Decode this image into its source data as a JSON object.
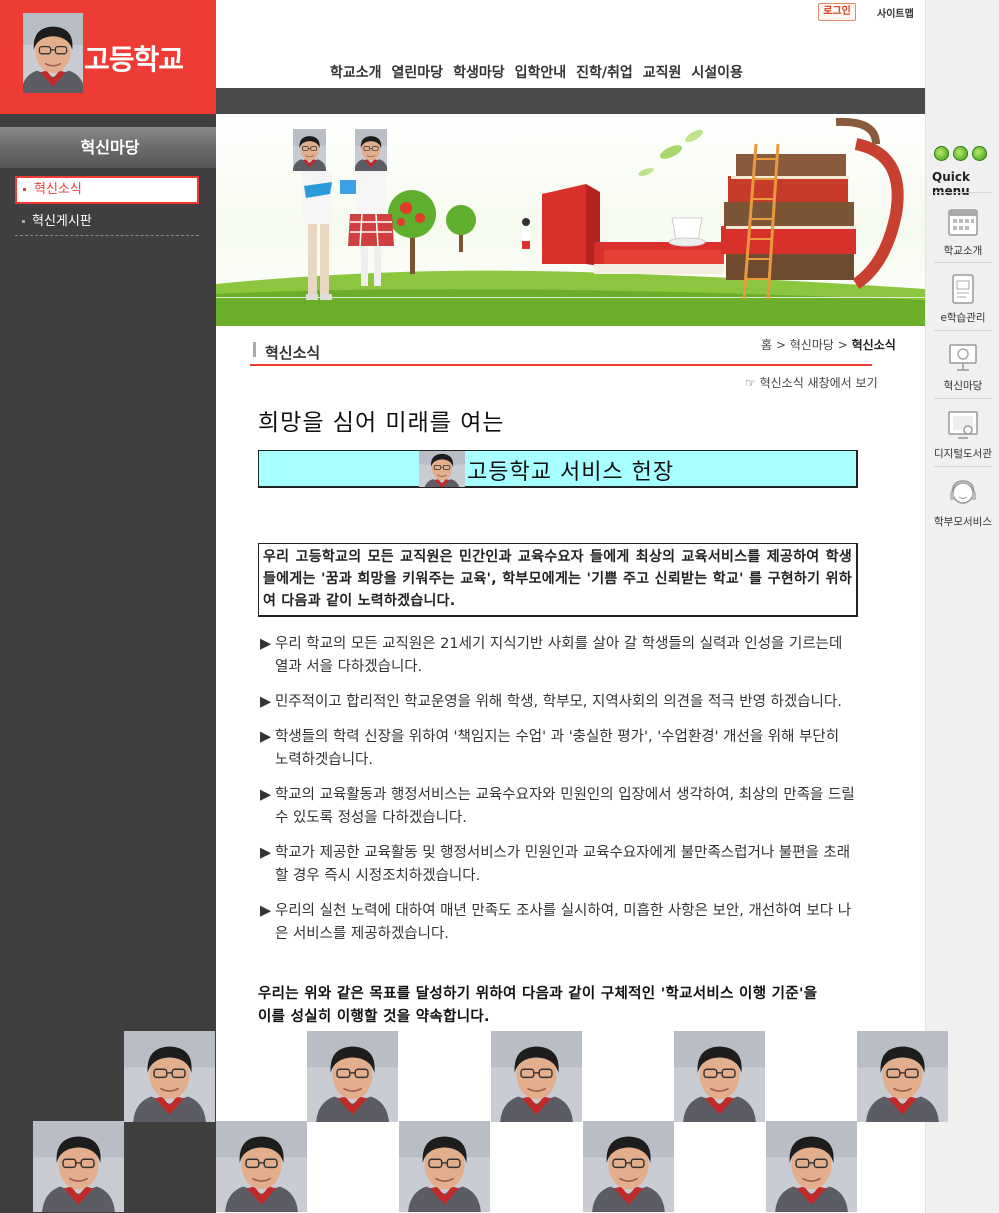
{
  "logo": {
    "title": "고등학교"
  },
  "util": {
    "login": "로그인",
    "sitemap": "사이트맵"
  },
  "gnb": [
    "학교소개",
    "열린마당",
    "학생마당",
    "입학안내",
    "진학/취업",
    "교직원",
    "시설이용"
  ],
  "sidebar": {
    "title": "혁신마당",
    "items": [
      {
        "label": "혁신소식",
        "active": true
      },
      {
        "label": "혁신게시판",
        "active": false
      }
    ]
  },
  "page": {
    "title": "혁신소식",
    "breadcrumb": [
      "홈",
      "혁신마당",
      "혁신소식"
    ],
    "new_window": "혁신소식 새창에서 보기"
  },
  "content": {
    "headline": "희망을 심어 미래를 여는",
    "banner_title": "고등학교 서비스 헌장",
    "intro": "우리       고등학교의 모든 교직원은 민간인과 교육수요자 들에게 최상의 교육서비스를 제공하여 학생들에게는 '꿈과 희망을 키워주는 교육', 학부모에게는 '기쁨 주고 신뢰받는 학교' 를 구현하기 위하여 다음과 같이 노력하겠습니다.",
    "bullets": [
      "우리 학교의 모든 교직원은 21세기 지식기반 사회를 살아 갈 학생들의 실력과 인성을 기르는데 열과 서을 다하겠습니다.",
      "민주적이고 합리적인 학교운영을 위해 학생, 학부모, 지역사회의 의견을 적극 반영 하겠습니다.",
      "학생들의 학력 신장을 위하여 '책임지는 수업' 과 '충실한 평가', '수업환경' 개선을 위해 부단히 노력하겟습니다.",
      "학교의 교육활동과 행정서비스는 교육수요자와 민원인의 입장에서 생각하여, 최상의 만족을 드릴 수 있도록 정성을 다하겠습니다.",
      "학교가 제공한 교육활동 및 행정서비스가 민원인과 교육수요자에게 불만족스럽거나 불편을 초래할 경우 즉시 시정조치하겠습니다.",
      "우리의 실천 노력에 대하여 매년 만족도 조사를 실시하여, 미흡한 사항은 보안, 개선하여 보다 나은 서비스를 제공하겠습니다."
    ],
    "bullet_marker": "▶",
    "pledge": "우리는 위와 같은 목표를 달성하기 위하여 다음과 같이 구체적인 '학교서비스 이행 기준'을 이를 성실히 이행할 것을 약속합니다."
  },
  "quick_menu": {
    "title": "Quick menu",
    "items": [
      {
        "label": "학교소개",
        "icon": "calendar-icon"
      },
      {
        "label": "e학습관리",
        "icon": "document-icon"
      },
      {
        "label": "혁신마당",
        "icon": "presentation-icon"
      },
      {
        "label": "디지털도서관",
        "icon": "monitor-icon"
      },
      {
        "label": "학부모서비스",
        "icon": "headset-icon"
      }
    ]
  },
  "colors": {
    "accent": "#ee3b36",
    "sidebar": "#3f3f3f",
    "highlight_box": "#a8ffff"
  }
}
